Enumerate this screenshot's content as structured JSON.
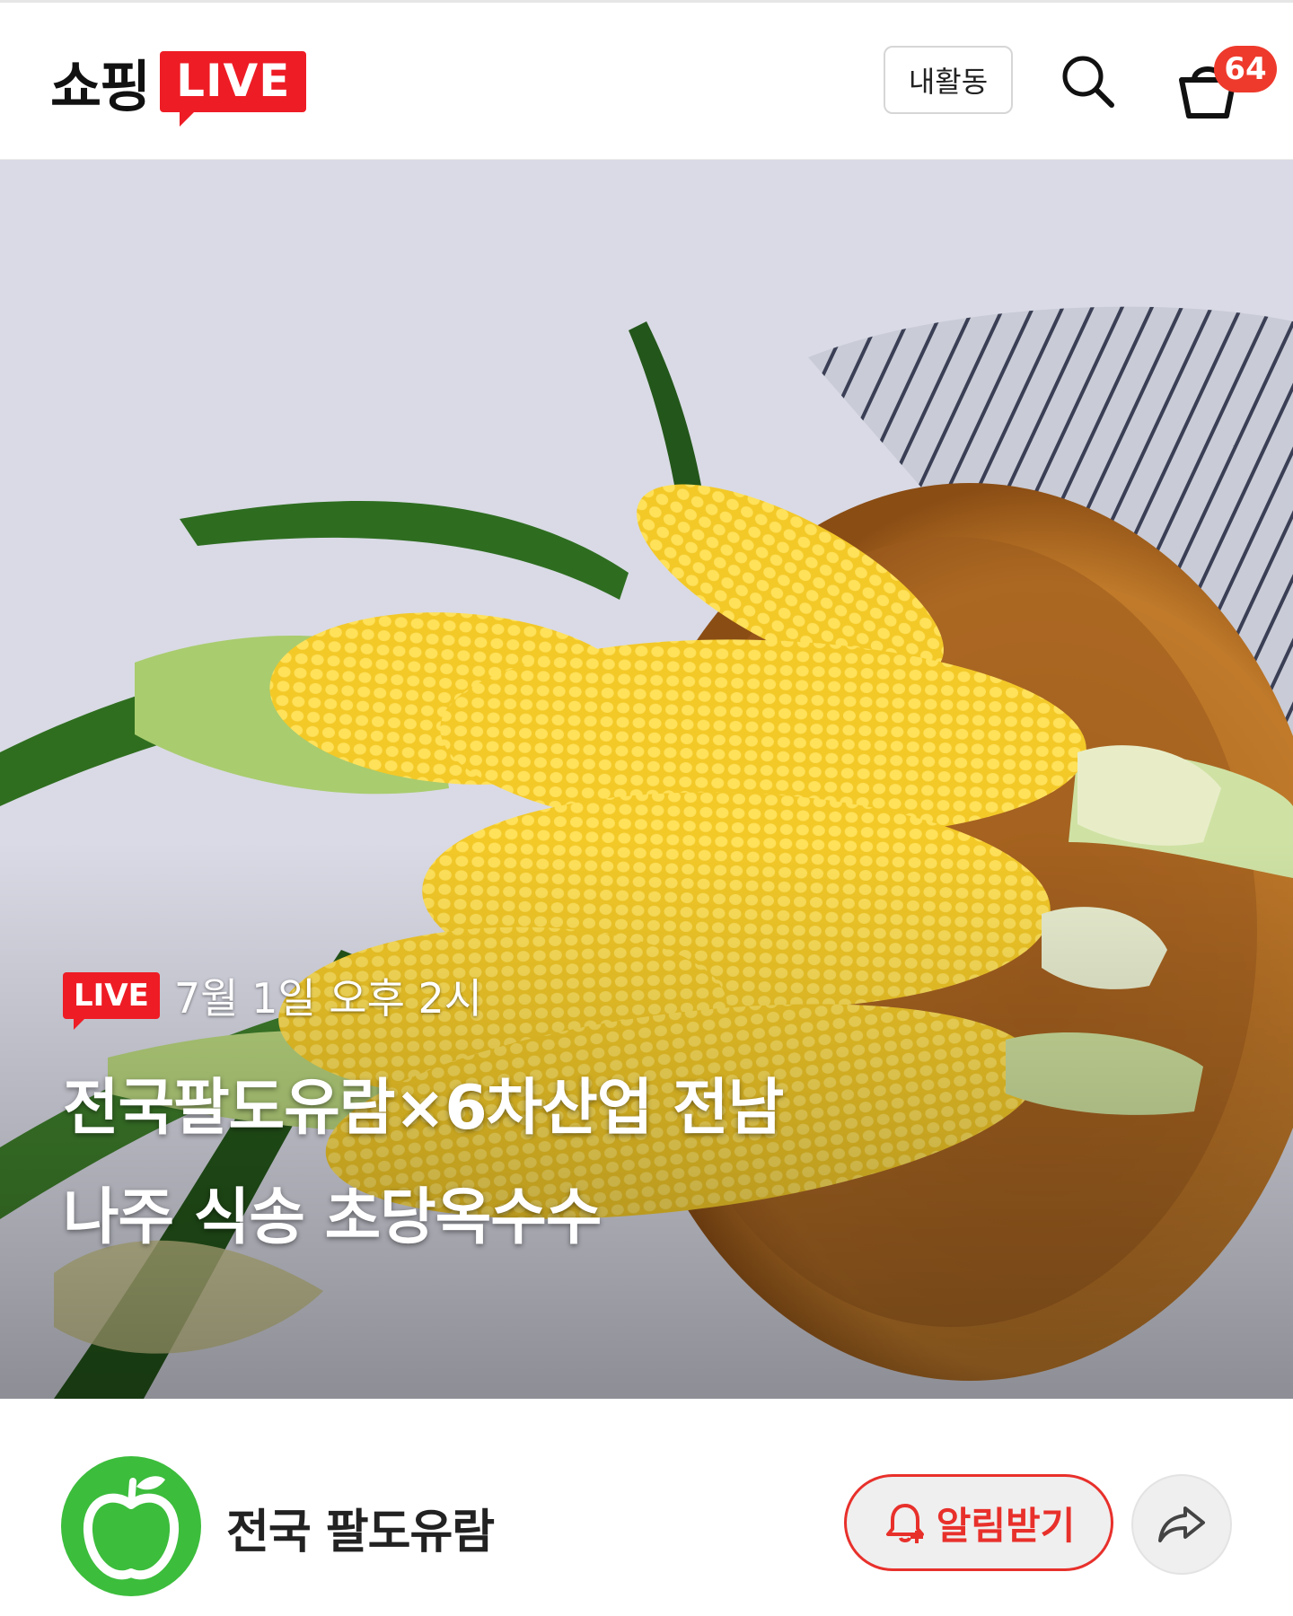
{
  "header": {
    "logo_text": "쇼핑",
    "logo_badge": "LIVE",
    "activity_label": "내활동",
    "cart_count": "64",
    "icons": {
      "search": "search-icon",
      "cart": "shopping-basket-icon"
    }
  },
  "hero": {
    "live_badge": "LIVE",
    "schedule": "7월 1일 오후 2시",
    "title_line1": "전국팔도유람×6차산업 전남",
    "title_line2": "나주 식송 초당옥수수"
  },
  "seller": {
    "name": "전국 팔도유람",
    "alarm_label": "알림받기",
    "icons": {
      "avatar": "green-apple-icon",
      "alarm": "bell-plus-icon",
      "share": "share-arrow-icon"
    }
  },
  "colors": {
    "brand_red": "#ee1c25",
    "accent_red": "#e8302b",
    "apple_green": "#3cbd3c"
  }
}
